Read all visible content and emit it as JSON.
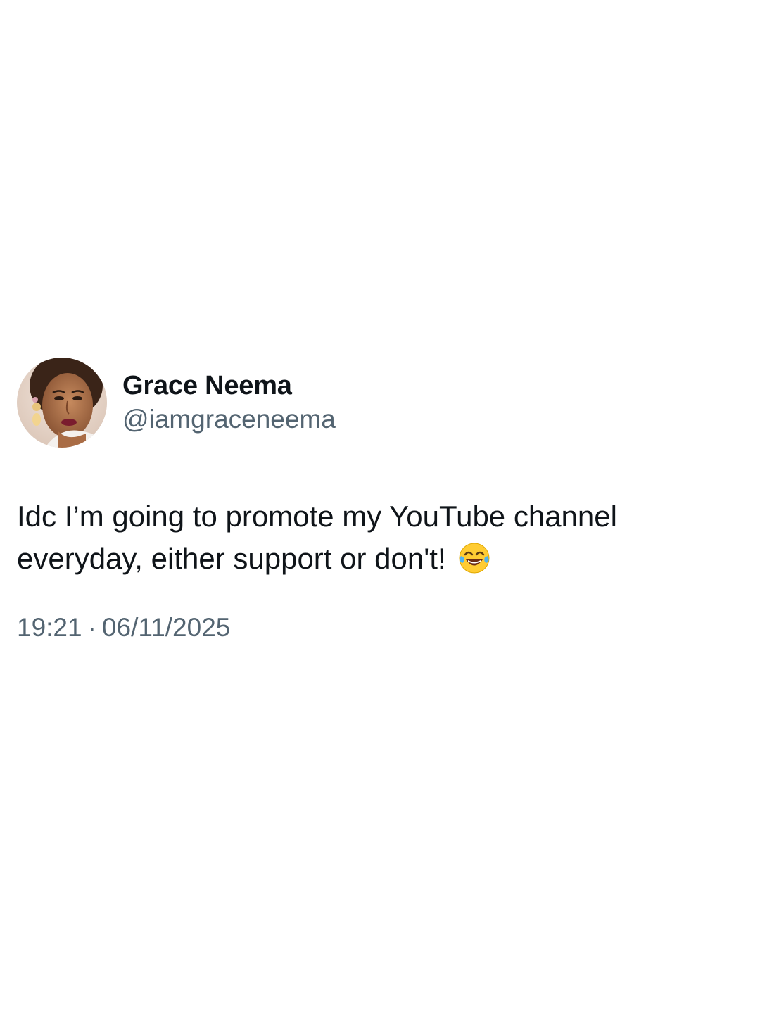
{
  "author": {
    "display_name": "Grace Neema",
    "handle": "@iamgraceneema",
    "avatar_icon": "profile-photo"
  },
  "tweet": {
    "text": "Idc I’m going to promote my YouTube channel everyday, either support or don't!",
    "emoji_icon": "face-with-tears-of-joy-emoji"
  },
  "meta": {
    "time": "19:21",
    "separator": "·",
    "date": "06/11/2025"
  },
  "colors": {
    "text_primary": "#0f1419",
    "text_secondary": "#536471",
    "background": "#ffffff"
  }
}
